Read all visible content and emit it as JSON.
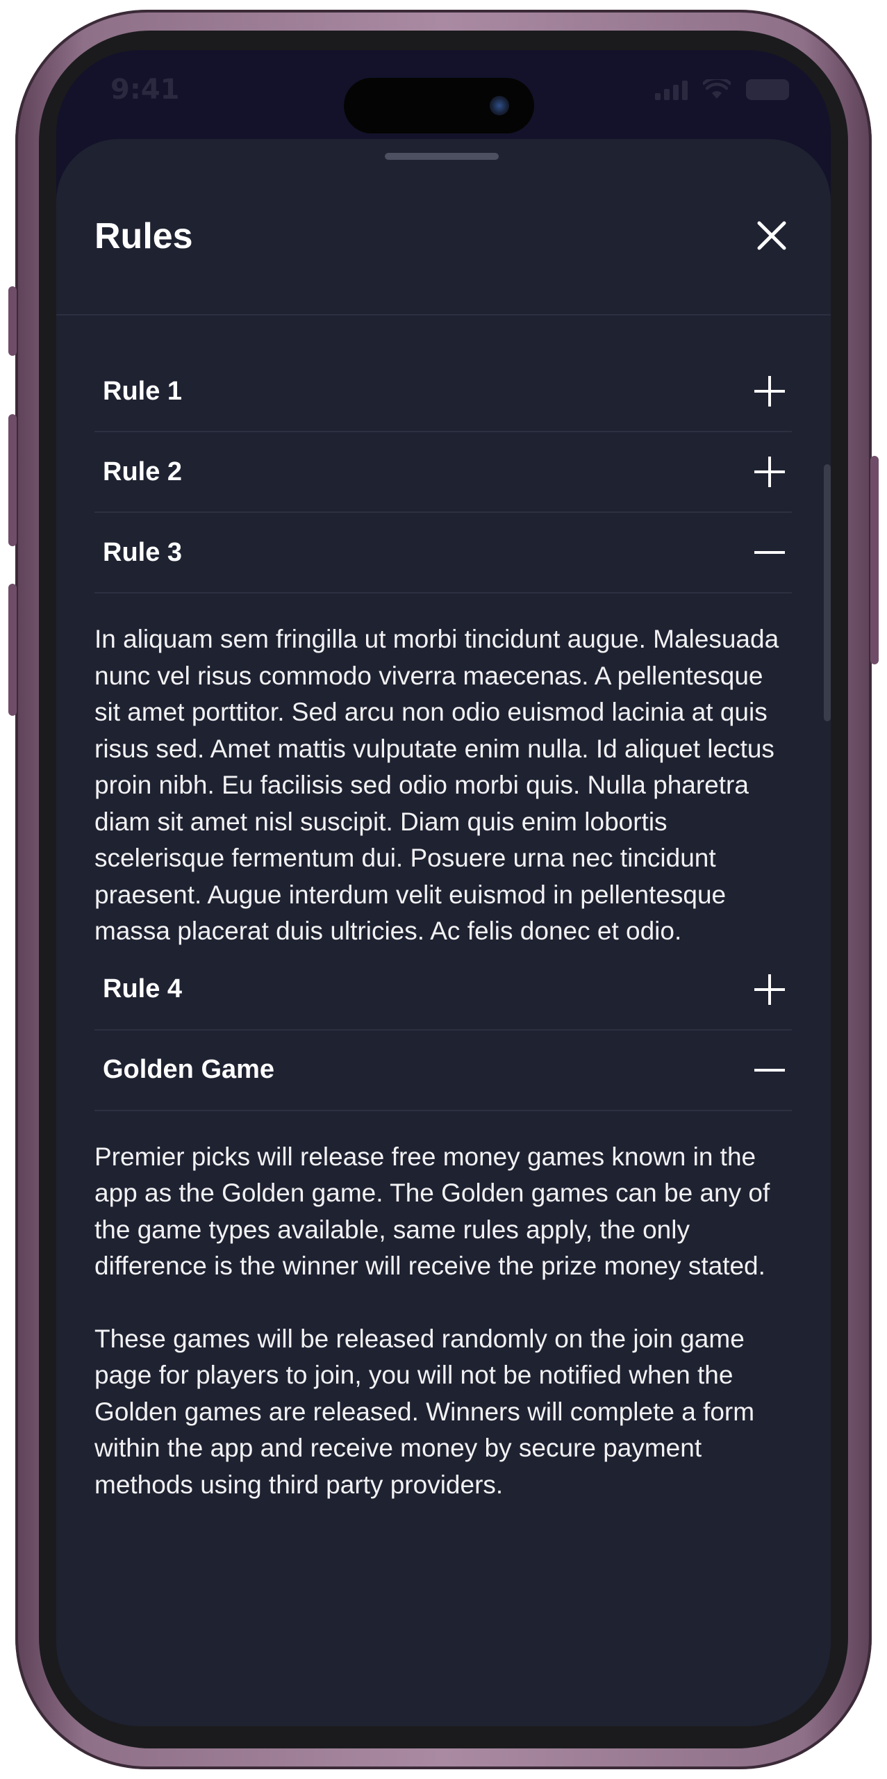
{
  "status_bar": {
    "time": "9:41"
  },
  "sheet": {
    "title": "Rules",
    "close_icon": "close-icon"
  },
  "rules": [
    {
      "title": "Rule 1",
      "expanded": false,
      "toggle_icon": "plus-icon",
      "paragraphs": []
    },
    {
      "title": "Rule 2",
      "expanded": false,
      "toggle_icon": "plus-icon",
      "paragraphs": []
    },
    {
      "title": "Rule 3",
      "expanded": true,
      "toggle_icon": "minus-icon",
      "paragraphs": [
        "In aliquam sem fringilla ut morbi tincidunt augue. Malesuada nunc vel risus commodo viverra maecenas. A pellentesque sit amet porttitor. Sed arcu non odio euismod lacinia at quis risus sed. Amet mattis vulputate enim nulla. Id aliquet lectus proin nibh. Eu facilisis sed odio morbi quis. Nulla pharetra diam sit amet nisl suscipit. Diam quis enim lobortis scelerisque fermentum dui. Posuere urna nec tincidunt praesent. Augue interdum velit euismod in pellentesque massa placerat duis ultricies. Ac felis donec et odio."
      ]
    },
    {
      "title": "Rule 4",
      "expanded": false,
      "toggle_icon": "plus-icon",
      "paragraphs": []
    },
    {
      "title": "Golden Game",
      "expanded": true,
      "toggle_icon": "minus-icon",
      "paragraphs": [
        "Premier picks will release free money games known in the app as the Golden game. The Golden games can be any of the game types available, same rules apply, the only difference is the winner will receive the prize money stated.",
        "These games will be released randomly on the join game page for players to join, you will not be notified when the Golden games are released. Winners will complete a form within the app and receive money by secure payment methods using third party providers."
      ]
    }
  ],
  "colors": {
    "sheet_background": "#1f2231",
    "divider": "#2c3040",
    "text": "#ffffff"
  }
}
